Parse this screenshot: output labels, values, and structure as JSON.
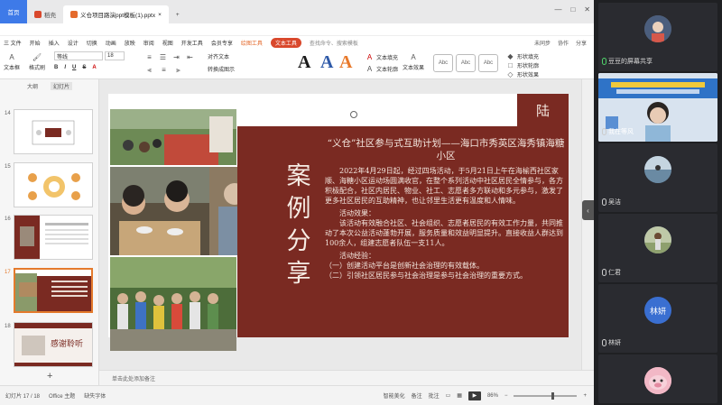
{
  "titlebar": {
    "tabs": [
      {
        "label": "首页",
        "type": "home"
      },
      {
        "label": "稻壳",
        "type": "normal",
        "color": "#d9482c"
      },
      {
        "label": "义仓项目路演ppt模板(1).pptx",
        "type": "active",
        "color": "#e46a2c"
      }
    ]
  },
  "menubar": {
    "items": [
      "三 文件",
      "开始",
      "插入",
      "设计",
      "切换",
      "动画",
      "放映",
      "审阅",
      "视图",
      "开发工具",
      "会员专享",
      "绘图工具",
      "文本工具"
    ],
    "search": "查找命令、搜索模板",
    "right": [
      "未同步",
      "协作",
      "分享"
    ]
  },
  "ribbon": {
    "textbox_label": "文本框",
    "font_name": "等线",
    "font_size": "18",
    "style_label": "格式刷",
    "bold_labels": [
      "B",
      "I",
      "U",
      "S"
    ],
    "align_label": "对齐文本",
    "convert_label": "转换成图示",
    "big_a_colors": [
      "#1a1a1a",
      "#2f5aa8",
      "#e8792b"
    ],
    "text_fill": "文本填充",
    "text_outline": "文本轮廓",
    "text_effects": "文本效果",
    "style_boxes": [
      "Abc",
      "Abc",
      "Abc"
    ],
    "shape_fill": "形状填充",
    "shape_outline": "形状轮廓",
    "shape_effect": "形状效果"
  },
  "leftpanel": {
    "tabs": [
      "大纲",
      "幻灯片"
    ],
    "slides": [
      {
        "num": "14"
      },
      {
        "num": "15"
      },
      {
        "num": "16"
      },
      {
        "num": "17",
        "selected": true
      },
      {
        "num": "18",
        "text": "感谢聆听"
      }
    ],
    "add_label": "+"
  },
  "slide": {
    "corner_text": "陆",
    "vertical_title": [
      "案",
      "例",
      "分",
      "享"
    ],
    "heading": "“义仓”社区参与式互助计划——海口市秀英区海秀镇海糖小区",
    "para1": "2022年4月29日起，经过四场活动，于5月21日上午在海榆西社区家顺、海糖小区运动场圆满收官，在整个系列活动中社区居民全情参与，各方积极配合，社区内居民、物业、社工、志愿者多方联动和多元参与，激发了更多社区居民的互助精神，也让邻里生活更有温度和人情味。",
    "effect_title": "活动效果：",
    "para2": "该活动有效融合社区、社会组织、志愿者居民的有效工作力量，共同推动了本次公益活动蓬勃开展，服务质量和效益明显提升。直接收益人群达到100余人，组建志愿者队伍一支11人。",
    "exp_title": "活动经验：",
    "exp1": "（一）创建活动平台是创新社会治理的有效载体。",
    "exp2": "（二）引领社区居民参与社会治理是参与社会治理的重要方式。"
  },
  "notes": {
    "placeholder": "单击此处添加备注"
  },
  "statusbar": {
    "slide_count": "幻灯片 17 / 18",
    "theme": "Office 主题",
    "missing_font": "缺失字体",
    "beautify": "智能美化",
    "notes": "备注",
    "comments": "批注",
    "zoom": "86%"
  },
  "meeting": {
    "participants": [
      {
        "name": "豆豆的屏幕共享",
        "type": "avatar"
      },
      {
        "name": "我在等风",
        "type": "video"
      },
      {
        "name": "吴洁",
        "type": "avatar"
      },
      {
        "name": "仁君",
        "type": "avatar"
      },
      {
        "name": "林妍",
        "type": "initials",
        "initials": "林妍"
      },
      {
        "name": "",
        "type": "avatar"
      }
    ]
  }
}
